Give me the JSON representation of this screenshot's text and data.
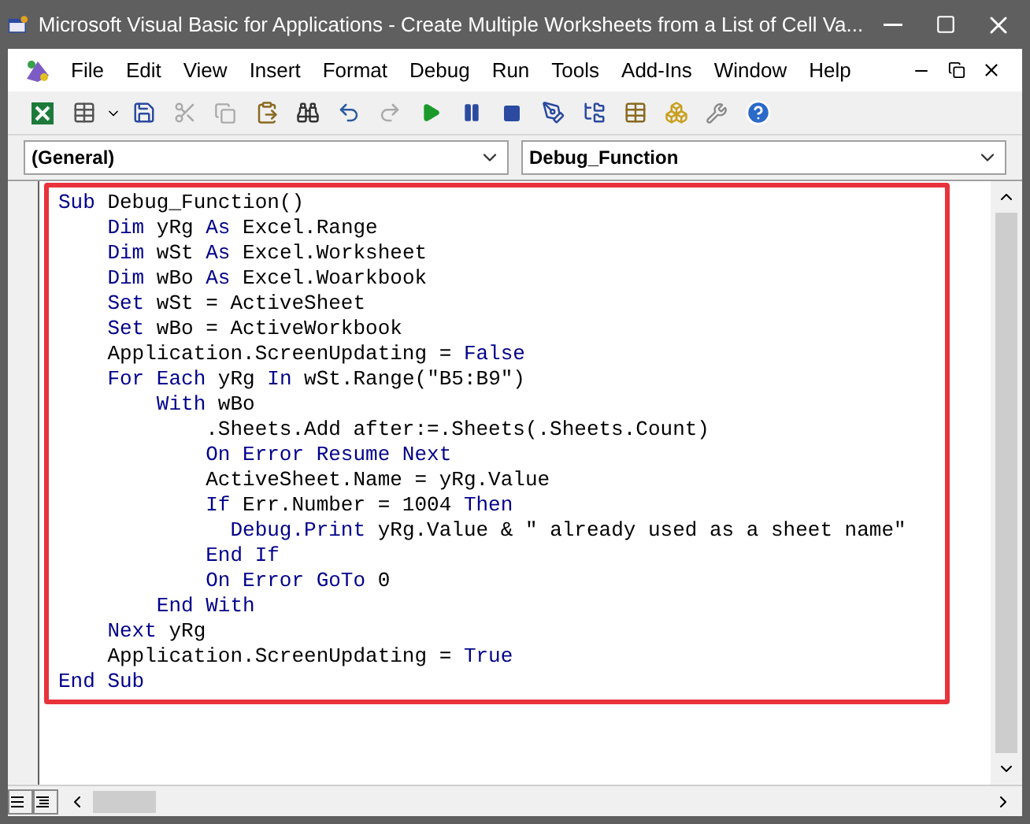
{
  "window": {
    "title": "Microsoft Visual Basic for Applications - Create Multiple Worksheets from a List of Cell Va..."
  },
  "menu": [
    {
      "label": "File"
    },
    {
      "label": "Edit"
    },
    {
      "label": "View"
    },
    {
      "label": "Insert"
    },
    {
      "label": "Format"
    },
    {
      "label": "Debug"
    },
    {
      "label": "Run"
    },
    {
      "label": "Tools"
    },
    {
      "label": "Add-Ins"
    },
    {
      "label": "Window"
    },
    {
      "label": "Help"
    }
  ],
  "object_dropdown": {
    "value": "(General)"
  },
  "procedure_dropdown": {
    "value": "Debug_Function"
  },
  "code_lines": [
    [
      {
        "kind": "keyword",
        "text": "Sub"
      },
      {
        "kind": "plain",
        "text": " Debug_Function()"
      }
    ],
    [
      {
        "kind": "keyword",
        "text": "    Dim"
      },
      {
        "kind": "plain",
        "text": " yRg "
      },
      {
        "kind": "keyword",
        "text": "As"
      },
      {
        "kind": "plain",
        "text": " Excel.Range"
      }
    ],
    [
      {
        "kind": "keyword",
        "text": "    Dim"
      },
      {
        "kind": "plain",
        "text": " wSt "
      },
      {
        "kind": "keyword",
        "text": "As"
      },
      {
        "kind": "plain",
        "text": " Excel.Worksheet"
      }
    ],
    [
      {
        "kind": "keyword",
        "text": "    Dim"
      },
      {
        "kind": "plain",
        "text": " wBo "
      },
      {
        "kind": "keyword",
        "text": "As"
      },
      {
        "kind": "plain",
        "text": " Excel.Woarkbook"
      }
    ],
    [
      {
        "kind": "keyword",
        "text": "    Set"
      },
      {
        "kind": "plain",
        "text": " wSt = ActiveSheet"
      }
    ],
    [
      {
        "kind": "keyword",
        "text": "    Set"
      },
      {
        "kind": "plain",
        "text": " wBo = ActiveWorkbook"
      }
    ],
    [
      {
        "kind": "plain",
        "text": "    Application.ScreenUpdating = "
      },
      {
        "kind": "keyword",
        "text": "False"
      }
    ],
    [
      {
        "kind": "keyword",
        "text": "    For Each"
      },
      {
        "kind": "plain",
        "text": " yRg "
      },
      {
        "kind": "keyword",
        "text": "In"
      },
      {
        "kind": "plain",
        "text": " wSt.Range(\"B5:B9\")"
      }
    ],
    [
      {
        "kind": "keyword",
        "text": "        With"
      },
      {
        "kind": "plain",
        "text": " wBo"
      }
    ],
    [
      {
        "kind": "plain",
        "text": "            .Sheets.Add after:=.Sheets(.Sheets.Count)"
      }
    ],
    [
      {
        "kind": "keyword",
        "text": "            On Error Resume Next"
      }
    ],
    [
      {
        "kind": "plain",
        "text": "            ActiveSheet.Name = yRg.Value"
      }
    ],
    [
      {
        "kind": "keyword",
        "text": "            If"
      },
      {
        "kind": "plain",
        "text": " Err.Number = 1004 "
      },
      {
        "kind": "keyword",
        "text": "Then"
      }
    ],
    [
      {
        "kind": "keyword",
        "text": "              Debug.Print"
      },
      {
        "kind": "plain",
        "text": " yRg.Value & \" already used as a sheet name\""
      }
    ],
    [
      {
        "kind": "keyword",
        "text": "            End If"
      }
    ],
    [
      {
        "kind": "keyword",
        "text": "            On Error GoTo"
      },
      {
        "kind": "plain",
        "text": " 0"
      }
    ],
    [
      {
        "kind": "keyword",
        "text": "        End With"
      }
    ],
    [
      {
        "kind": "keyword",
        "text": "    Next"
      },
      {
        "kind": "plain",
        "text": " yRg"
      }
    ],
    [
      {
        "kind": "plain",
        "text": "    Application.ScreenUpdating = "
      },
      {
        "kind": "keyword",
        "text": "True"
      }
    ],
    [
      {
        "kind": "keyword",
        "text": "End Sub"
      }
    ]
  ]
}
